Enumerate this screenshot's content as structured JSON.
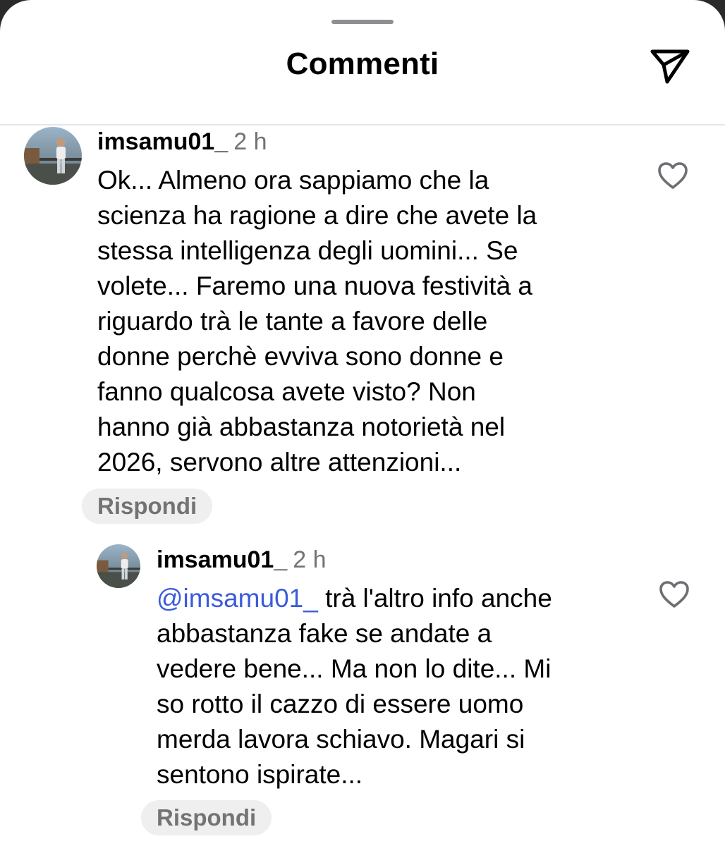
{
  "header": {
    "title": "Commenti",
    "share_icon": "send-paper-plane-icon"
  },
  "comments": [
    {
      "username": "imsamu01_",
      "time": "2 h",
      "text": "Ok... Almeno ora sappiamo che la\nscienza ha ragione a dire che avete la\nstessa intelligenza degli uomini... Se\nvolete... Faremo una nuova festività a\nriguardo trà le tante a favore delle\ndonne perchè evviva sono donne e\nfanno qualcosa avete visto? Non\nhanno già abbastanza notorietà nel\n2026, servono altre attenzioni...",
      "reply_label": "Rispondi",
      "like_icon": "heart-outline-icon"
    },
    {
      "username": "imsamu01_",
      "time": "2 h",
      "mention": "@imsamu01_",
      "text": " trà l'altro info anche\nabbastanza fake se andate a\nvedere bene... Ma non lo dite... Mi\nso rotto il cazzo di essere uomo\nmerda lavora schiavo. Magari si\nsentono ispirate...",
      "reply_label": "Rispondi",
      "like_icon": "heart-outline-icon"
    }
  ],
  "colors": {
    "mention": "#3b5bdb",
    "secondary_text": "#737373",
    "reply_bg": "#efeff0"
  }
}
